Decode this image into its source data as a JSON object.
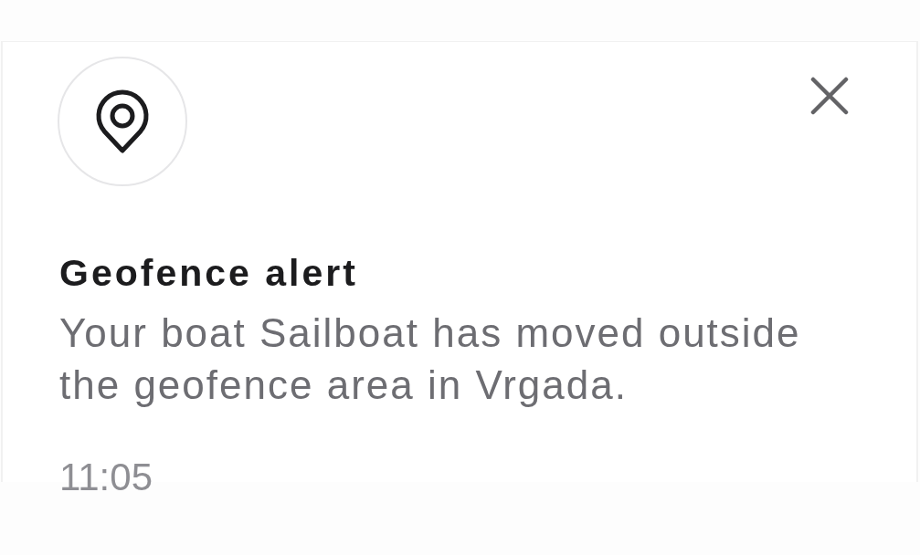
{
  "notification": {
    "title": "Geofence alert",
    "message": "Your boat Sailboat has moved outside the geofence area in Vrgada.",
    "time": "11:05"
  }
}
